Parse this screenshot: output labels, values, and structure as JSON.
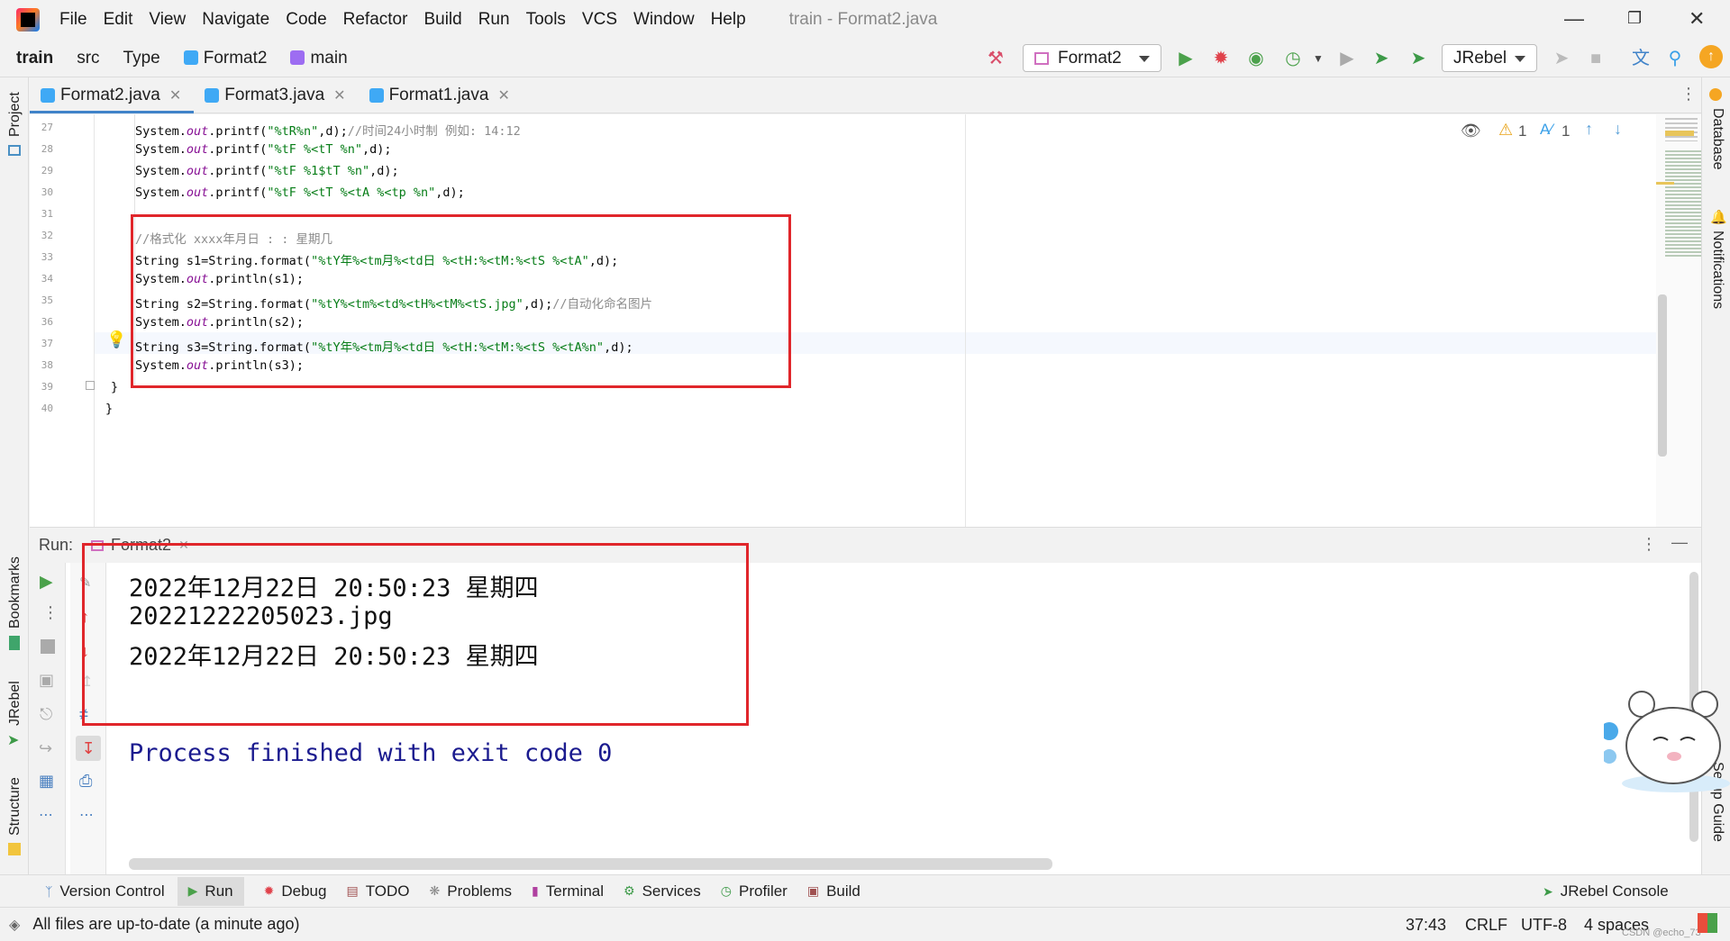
{
  "menu": {
    "items": [
      "File",
      "Edit",
      "View",
      "Navigate",
      "Code",
      "Refactor",
      "Build",
      "Run",
      "Tools",
      "VCS",
      "Window",
      "Help"
    ],
    "window_title": "train - Format2.java"
  },
  "nav": {
    "project": "train",
    "src": "src",
    "type": "Type",
    "class": "Format2",
    "method": "main",
    "run_config": "Format2",
    "jrebel_select": "JRebel"
  },
  "side": {
    "left": [
      "Project",
      "Bookmarks",
      "JRebel",
      "Structure"
    ],
    "right": [
      "Database",
      "Notifications",
      "Setup Guide"
    ]
  },
  "tabs": [
    {
      "label": "Format2.java",
      "active": true
    },
    {
      "label": "Format3.java",
      "active": false
    },
    {
      "label": "Format1.java",
      "active": false
    }
  ],
  "inspection": {
    "warnings": "1",
    "typos": "1"
  },
  "code": {
    "line_numbers": [
      "27",
      "28",
      "29",
      "30",
      "31",
      "32",
      "33",
      "34",
      "35",
      "36",
      "37",
      "38",
      "39",
      "40"
    ],
    "l27": {
      "a": "System.",
      "b": "out",
      "c": ".printf(",
      "d": "\"%tR%n\"",
      "e": ",d);",
      "f": "//时间24小时制 例如: 14:12"
    },
    "l28": {
      "a": "System.",
      "b": "out",
      "c": ".printf(",
      "d": "\"%tF %<tT %n\"",
      "e": ",d);"
    },
    "l29": {
      "a": "System.",
      "b": "out",
      "c": ".printf(",
      "d": "\"%tF %1$tT %n\"",
      "e": ",d);"
    },
    "l30": {
      "a": "System.",
      "b": "out",
      "c": ".printf(",
      "d": "\"%tF %<tT %<tA %<tp %n\"",
      "e": ",d);"
    },
    "l32": "//格式化 xxxx年月日 : : 星期几",
    "l33": {
      "a": "String s1=String.format(",
      "d": "\"%tY年%<tm月%<td日 %<tH:%<tM:%<tS %<tA\"",
      "e": ",d);"
    },
    "l34": {
      "a": "System.",
      "b": "out",
      "c": ".println(s1);"
    },
    "l35": {
      "a": "String s2=String.format(",
      "d": "\"%tY%<tm%<td%<tH%<tM%<tS.jpg\"",
      "e": ",d);",
      "f": "//自动化命名图片"
    },
    "l36": {
      "a": "System.",
      "b": "out",
      "c": ".println(s2);"
    },
    "l37": {
      "a": "String s3=String.format(",
      "d": "\"%tY年%<tm月%<td日 %<tH:%<tM:%<tS %<tA%n\"",
      "e": ",d);"
    },
    "l38": {
      "a": "System.",
      "b": "out",
      "c": ".println(s3);"
    },
    "l39": "}",
    "l40": "}"
  },
  "run": {
    "label": "Run:",
    "tab": "Format2",
    "output": [
      "2022年12月22日 20:50:23 星期四",
      "20221222205023.jpg",
      "2022年12月22日 20:50:23 星期四",
      "",
      "Process finished with exit code 0"
    ]
  },
  "toolwindows": [
    "Version Control",
    "Run",
    "Debug",
    "TODO",
    "Problems",
    "Terminal",
    "Services",
    "Profiler",
    "Build",
    "JRebel Console"
  ],
  "status": {
    "message": "All files are up-to-date (a minute ago)",
    "position": "37:43",
    "line_sep": "CRLF",
    "encoding": "UTF-8",
    "indent": "4 spaces",
    "watermark": "CSDN @echo_73"
  },
  "colors": {
    "accent": "#4083c9",
    "annotation_red": "#e0262b",
    "run_green": "#4ba14b",
    "debug_red": "#e0424b"
  }
}
